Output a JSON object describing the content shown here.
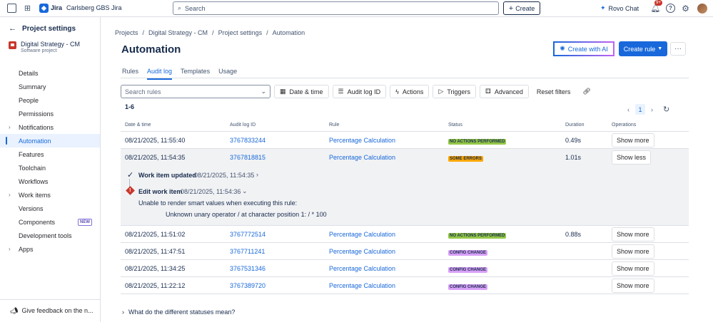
{
  "topbar": {
    "brand": "Jira",
    "site": "Carlsberg GBS Jira",
    "search_placeholder": "Search",
    "create_label": "Create",
    "rovo_label": "Rovo Chat",
    "notifications_badge": "9+"
  },
  "sidebar": {
    "back_label": "Project settings",
    "project_name": "Digital Strategy - CM",
    "project_type": "Software project",
    "items": [
      {
        "label": "Details"
      },
      {
        "label": "Summary"
      },
      {
        "label": "People"
      },
      {
        "label": "Permissions"
      },
      {
        "label": "Notifications"
      },
      {
        "label": "Automation"
      },
      {
        "label": "Features"
      },
      {
        "label": "Toolchain"
      },
      {
        "label": "Workflows"
      },
      {
        "label": "Work items"
      },
      {
        "label": "Versions"
      },
      {
        "label": "Components",
        "badge": "NEW"
      },
      {
        "label": "Development tools"
      },
      {
        "label": "Apps"
      }
    ],
    "feedback_label": "Give feedback on the n..."
  },
  "breadcrumbs": [
    "Projects",
    "Digital Strategy - CM",
    "Project settings",
    "Automation"
  ],
  "page": {
    "title": "Automation",
    "create_ai_label": "Create with AI",
    "create_rule_label": "Create rule"
  },
  "tabs": [
    "Rules",
    "Audit log",
    "Templates",
    "Usage"
  ],
  "filters": {
    "search_placeholder": "Search rules",
    "date_time": "Date & time",
    "audit_log_id": "Audit log ID",
    "actions": "Actions",
    "triggers": "Triggers",
    "advanced": "Advanced",
    "reset": "Reset filters"
  },
  "results_count": "1-6",
  "pagination": {
    "current_page": "1"
  },
  "table": {
    "headers": [
      "Date & time",
      "Audit log ID",
      "Rule",
      "Status",
      "Duration",
      "Operations"
    ],
    "rows": [
      {
        "date": "08/21/2025, 11:55:40",
        "id": "3767833244",
        "rule": "Percentage Calculation",
        "status": "NO ACTIONS PERFORMED",
        "duration": "0.49s",
        "op": "Show more"
      },
      {
        "date": "08/21/2025, 11:54:35",
        "id": "3767818815",
        "rule": "Percentage Calculation",
        "status": "SOME ERRORS",
        "duration": "1.01s",
        "op": "Show less"
      },
      {
        "date": "08/21/2025, 11:51:02",
        "id": "3767772514",
        "rule": "Percentage Calculation",
        "status": "NO ACTIONS PERFORMED",
        "duration": "0.88s",
        "op": "Show more"
      },
      {
        "date": "08/21/2025, 11:47:51",
        "id": "3767711241",
        "rule": "Percentage Calculation",
        "status": "CONFIG CHANGE",
        "duration": "",
        "op": "Show more"
      },
      {
        "date": "08/21/2025, 11:34:25",
        "id": "3767531346",
        "rule": "Percentage Calculation",
        "status": "CONFIG CHANGE",
        "duration": "",
        "op": "Show more"
      },
      {
        "date": "08/21/2025, 11:22:12",
        "id": "3767389720",
        "rule": "Percentage Calculation",
        "status": "CONFIG CHANGE",
        "duration": "",
        "op": "Show more"
      }
    ]
  },
  "detail": {
    "step1_title": "Work item updated",
    "step1_time": "08/21/2025, 11:54:35",
    "step2_title": "Edit work item",
    "step2_time": "08/21/2025, 11:54:36",
    "error_msg": "Unable to render smart values when executing this rule:",
    "error_detail": "Unknown unary operator / at character position 1: / * 100"
  },
  "statuses_help": "What do the different statuses mean?",
  "colors": {
    "accent": "#1868db",
    "no_actions": "#94c748",
    "some_errors": "#fca700",
    "config_change": "#d8a0f7"
  }
}
